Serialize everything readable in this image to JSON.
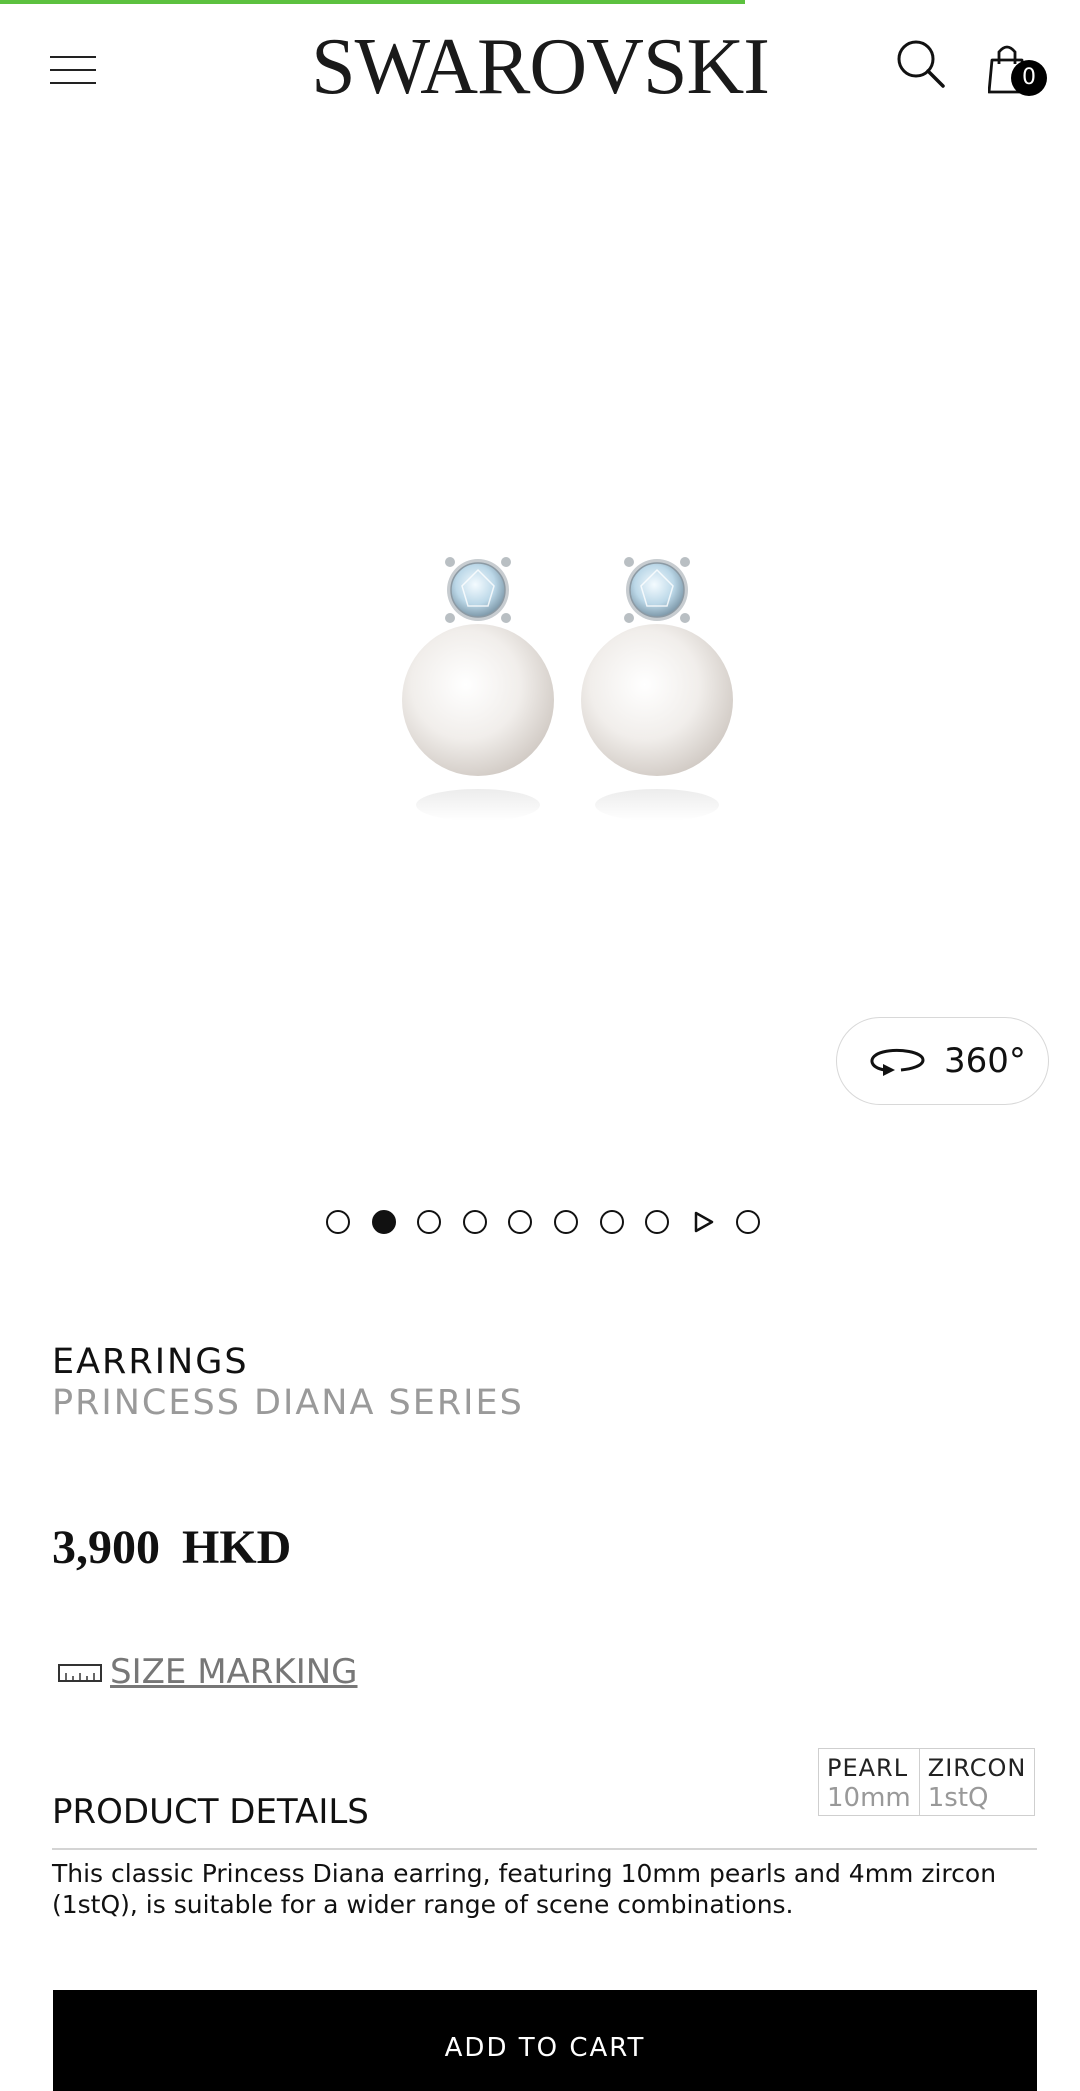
{
  "progress": {
    "fraction": 0.69,
    "color": "#5cc13f"
  },
  "header": {
    "brand": "SWAROVSKI",
    "menu_icon": "hamburger-menu-icon",
    "search_icon": "search-icon",
    "cart_icon": "shopping-bag-icon",
    "cart_count": "0"
  },
  "gallery": {
    "image_alt": "pearl stud earrings with zircon",
    "view_360_label": "360°",
    "view_360_icon": "rotate-360-icon",
    "dots": [
      {
        "type": "dot",
        "active": false
      },
      {
        "type": "dot",
        "active": true
      },
      {
        "type": "dot",
        "active": false
      },
      {
        "type": "dot",
        "active": false
      },
      {
        "type": "dot",
        "active": false
      },
      {
        "type": "dot",
        "active": false
      },
      {
        "type": "dot",
        "active": false
      },
      {
        "type": "dot",
        "active": false
      },
      {
        "type": "video",
        "active": false
      },
      {
        "type": "dot",
        "active": false
      }
    ]
  },
  "product": {
    "category": "EARRINGS",
    "series": "PRINCESS DIANA SERIES",
    "price_value": "3,900",
    "price_currency": "HKD",
    "size_marking_label": "SIZE MARKING",
    "size_marking_icon": "ruler-icon",
    "specs": [
      {
        "name": "PEARL",
        "value": "10mm"
      },
      {
        "name": "ZIRCON",
        "value": "1stQ"
      }
    ],
    "details_title": "PRODUCT DETAILS",
    "description": "This classic Princess Diana earring, featuring 10mm pearls and 4mm zircon (1stQ), is suitable for a wider range of scene combinations."
  },
  "actions": {
    "add_to_cart": "ADD TO CART"
  },
  "colors": {
    "accent": "#5cc13f",
    "button_bg": "#000000",
    "muted_text": "#9a9a9a"
  }
}
